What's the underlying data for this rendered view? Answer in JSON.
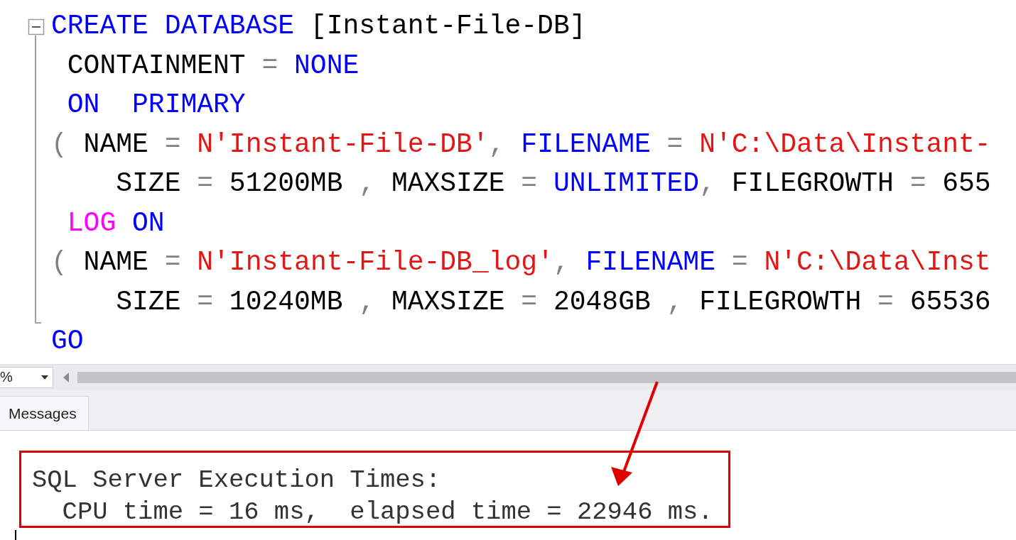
{
  "editor": {
    "lines": [
      {
        "tokens": [
          {
            "kind": "keyword",
            "text": "CREATE DATABASE "
          },
          {
            "kind": "plain",
            "text": "[Instant-File-DB]"
          }
        ]
      },
      {
        "tokens": [
          {
            "kind": "plain",
            "text": " CONTAINMENT "
          },
          {
            "kind": "operator",
            "text": "= "
          },
          {
            "kind": "keyword",
            "text": "NONE"
          }
        ]
      },
      {
        "tokens": [
          {
            "kind": "keyword",
            "text": " ON  PRIMARY"
          }
        ]
      },
      {
        "tokens": [
          {
            "kind": "operator",
            "text": "( "
          },
          {
            "kind": "plain",
            "text": "NAME "
          },
          {
            "kind": "operator",
            "text": "= "
          },
          {
            "kind": "string",
            "text": "N'Instant-File-DB'"
          },
          {
            "kind": "operator",
            "text": ", "
          },
          {
            "kind": "keyword",
            "text": "FILENAME "
          },
          {
            "kind": "operator",
            "text": "= "
          },
          {
            "kind": "string",
            "text": "N'C:\\Data\\Instant-"
          }
        ]
      },
      {
        "tokens": [
          {
            "kind": "plain",
            "text": "    SIZE "
          },
          {
            "kind": "operator",
            "text": "= "
          },
          {
            "kind": "plain",
            "text": "51200MB "
          },
          {
            "kind": "operator",
            "text": ", "
          },
          {
            "kind": "plain",
            "text": "MAXSIZE "
          },
          {
            "kind": "operator",
            "text": "= "
          },
          {
            "kind": "keyword",
            "text": "UNLIMITED"
          },
          {
            "kind": "operator",
            "text": ", "
          },
          {
            "kind": "plain",
            "text": "FILEGROWTH "
          },
          {
            "kind": "operator",
            "text": "= "
          },
          {
            "kind": "plain",
            "text": "655"
          }
        ]
      },
      {
        "tokens": [
          {
            "kind": "function",
            "text": " LOG "
          },
          {
            "kind": "keyword",
            "text": "ON"
          }
        ]
      },
      {
        "tokens": [
          {
            "kind": "operator",
            "text": "( "
          },
          {
            "kind": "plain",
            "text": "NAME "
          },
          {
            "kind": "operator",
            "text": "= "
          },
          {
            "kind": "string",
            "text": "N'Instant-File-DB_log'"
          },
          {
            "kind": "operator",
            "text": ", "
          },
          {
            "kind": "keyword",
            "text": "FILENAME "
          },
          {
            "kind": "operator",
            "text": "= "
          },
          {
            "kind": "string",
            "text": "N'C:\\Data\\Inst"
          }
        ]
      },
      {
        "tokens": [
          {
            "kind": "plain",
            "text": "    SIZE "
          },
          {
            "kind": "operator",
            "text": "= "
          },
          {
            "kind": "plain",
            "text": "10240MB "
          },
          {
            "kind": "operator",
            "text": ", "
          },
          {
            "kind": "plain",
            "text": "MAXSIZE "
          },
          {
            "kind": "operator",
            "text": "= "
          },
          {
            "kind": "plain",
            "text": "2048GB "
          },
          {
            "kind": "operator",
            "text": ", "
          },
          {
            "kind": "plain",
            "text": "FILEGROWTH "
          },
          {
            "kind": "operator",
            "text": "= "
          },
          {
            "kind": "plain",
            "text": "65536"
          }
        ]
      },
      {
        "tokens": [
          {
            "kind": "keyword",
            "text": "GO"
          }
        ]
      }
    ]
  },
  "zoom": {
    "value": "%"
  },
  "results_tabs": [
    {
      "label": "Messages",
      "selected": true
    }
  ],
  "messages": {
    "lines": [
      "SQL Server Execution Times:",
      "  CPU time = 16 ms,  elapsed time = 22946 ms."
    ]
  }
}
